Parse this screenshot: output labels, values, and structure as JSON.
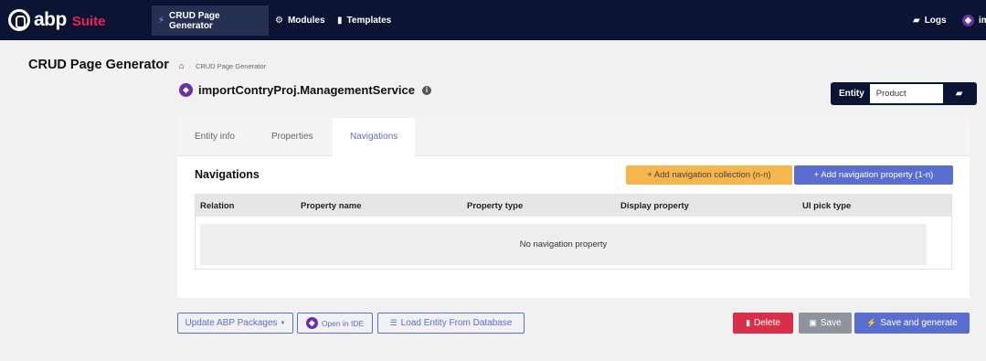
{
  "brand": {
    "name": "abp",
    "suffix": "Suite"
  },
  "topnav": {
    "items": [
      {
        "label": "CRUD Page Generator",
        "icon": "bolt-icon"
      },
      {
        "label": "Modules",
        "icon": "cogs-icon"
      },
      {
        "label": "Templates",
        "icon": "file-icon"
      }
    ],
    "right": [
      {
        "label": "Logs",
        "icon": "folder-icon"
      },
      {
        "label": "im",
        "icon": "visual-studio-icon"
      }
    ]
  },
  "header": {
    "title": "CRUD Page Generator",
    "breadcrumb": [
      "CRUD Page Generator"
    ],
    "project": "importContryProj.ManagementService"
  },
  "entity": {
    "label": "Entity",
    "value": "Product"
  },
  "tabs": [
    {
      "label": "Entity info",
      "active": false
    },
    {
      "label": "Properties",
      "active": false
    },
    {
      "label": "Navigations",
      "active": true
    }
  ],
  "navigations": {
    "heading": "Navigations",
    "add_collection": "+ Add navigation collection (n-n)",
    "add_property": "+ Add navigation property (1-n)",
    "columns": [
      "Relation",
      "Property name",
      "Property type",
      "Display property",
      "UI pick type"
    ],
    "empty": "No navigation property"
  },
  "footer": {
    "update": "Update ABP Packages",
    "open_ide": "Open in IDE",
    "load_db": "Load Entity From Database",
    "delete": "Delete",
    "save": "Save",
    "save_generate": "Save and generate"
  },
  "colors": {
    "topbar": "#0b1433",
    "accent": "#5a6ed0",
    "warning": "#f7b64d",
    "danger": "#d9304a",
    "secondary": "#8d949c",
    "brand_suite": "#e8225c"
  }
}
